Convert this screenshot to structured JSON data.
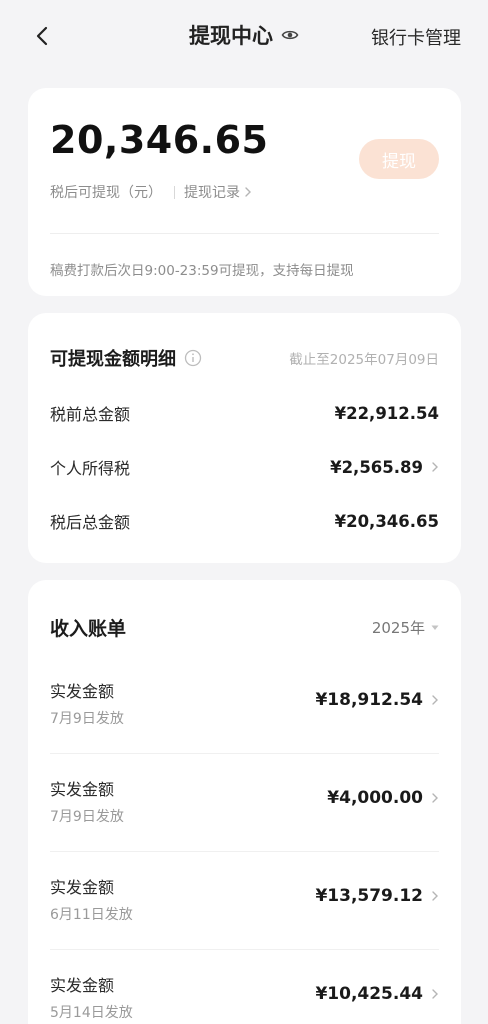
{
  "header": {
    "title": "提现中心",
    "right_action": "银行卡管理",
    "icons": {
      "back": "back-chevron-icon",
      "eye": "eye-icon"
    }
  },
  "balance": {
    "amount": "20,346.65",
    "withdraw_button": "提现",
    "label": "税后可提现（元）",
    "record_link": "提现记录",
    "notice": "稿费打款后次日9:00-23:59可提现，支持每日提现",
    "colors": {
      "button_bg": "#fbe2d4",
      "button_text": "#ffffff"
    }
  },
  "detail": {
    "title": "可提现金额明细",
    "as_of": "截止至2025年07月09日",
    "rows": [
      {
        "label": "税前总金额",
        "value": "¥22,912.54",
        "has_arrow": false
      },
      {
        "label": "个人所得税",
        "value": "¥2,565.89",
        "has_arrow": true
      },
      {
        "label": "税后总金额",
        "value": "¥20,346.65",
        "has_arrow": false
      }
    ]
  },
  "income": {
    "title": "收入账单",
    "year": "2025年",
    "items": [
      {
        "label": "实发金额",
        "date": "7月9日发放",
        "amount": "¥18,912.54"
      },
      {
        "label": "实发金额",
        "date": "7月9日发放",
        "amount": "¥4,000.00"
      },
      {
        "label": "实发金额",
        "date": "6月11日发放",
        "amount": "¥13,579.12"
      },
      {
        "label": "实发金额",
        "date": "5月14日发放",
        "amount": "¥10,425.44"
      }
    ]
  }
}
